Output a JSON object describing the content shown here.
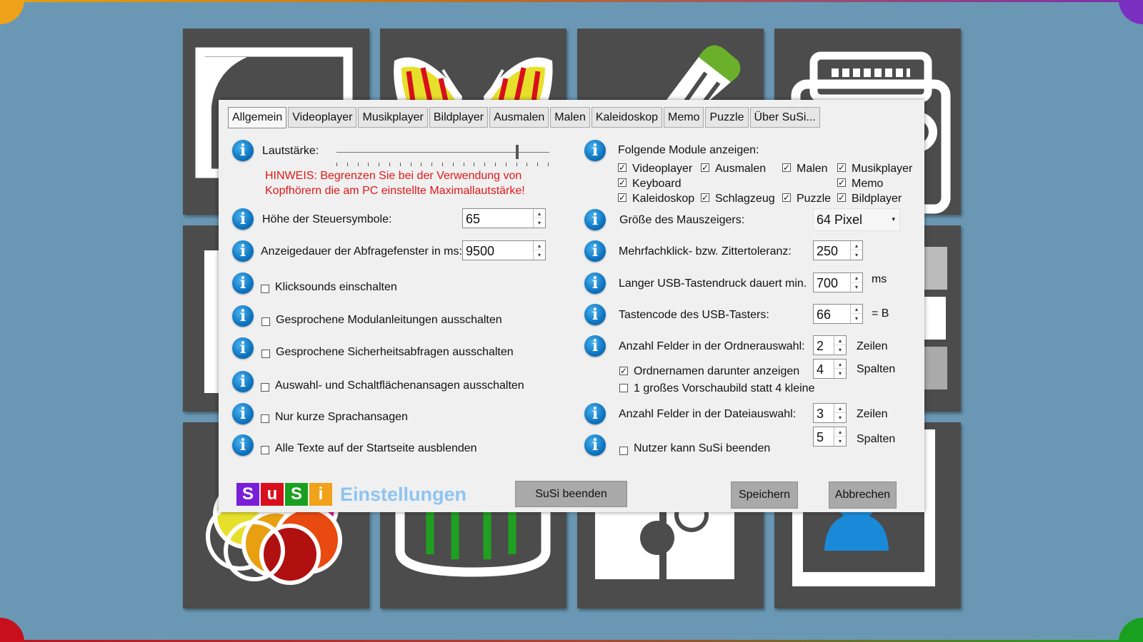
{
  "colors": {
    "background": "#6a98b4",
    "tile": "#4c4c4c",
    "dialog": "#f0f0f0",
    "hint": "#e01818",
    "info_icon": "#0e74c0",
    "logo_s1": "#7a1fd8",
    "logo_u": "#d8101e",
    "logo_s2": "#1aa020",
    "logo_i": "#f0a21a",
    "logo_title": "#8ec4f2"
  },
  "tabs": [
    "Allgemein",
    "Videoplayer",
    "Musikplayer",
    "Bildplayer",
    "Ausmalen",
    "Malen",
    "Kaleidoskop",
    "Memo",
    "Puzzle",
    "Über SuSi..."
  ],
  "active_tab": "Allgemein",
  "left": {
    "volume_label": "Lautstärke:",
    "volume_level": 0.85,
    "hint": "HINWEIS: Begrenzen Sie bei der Verwendung von",
    "hint2": "Kopfhörern die am PC einstellte Maximallautstärke!",
    "icon_height_label": "Höhe der Steuersymbole:",
    "icon_height_value": "65",
    "prompt_duration_label": "Anzeigedauer der Abfragefenster in ms:",
    "prompt_duration_value": "9500",
    "options": [
      {
        "label": "Klicksounds einschalten",
        "checked": false
      },
      {
        "label": "Gesprochene Modulanleitungen ausschalten",
        "checked": false
      },
      {
        "label": "Gesprochene Sicherheitsabfragen ausschalten",
        "checked": false
      },
      {
        "label": "Auswahl- und Schaltflächenansagen ausschalten",
        "checked": false
      },
      {
        "label": "Nur kurze Sprachansagen",
        "checked": false
      },
      {
        "label": "Alle Texte auf der Startseite ausblenden",
        "checked": false
      }
    ]
  },
  "right": {
    "modules_label": "Folgende Module anzeigen:",
    "modules": [
      {
        "label": "Videoplayer",
        "checked": true
      },
      {
        "label": "Ausmalen",
        "checked": true
      },
      {
        "label": "Malen",
        "checked": true
      },
      {
        "label": "Musikplayer",
        "checked": true
      },
      {
        "label": "Keyboard",
        "checked": true
      },
      {
        "label": "Memo",
        "checked": true
      },
      {
        "label": "Kaleidoskop",
        "checked": true
      },
      {
        "label": "Schlagzeug",
        "checked": true
      },
      {
        "label": "Puzzle",
        "checked": true
      },
      {
        "label": "Bildplayer",
        "checked": true
      }
    ],
    "cursor_size_label": "Größe des Mauszeigers:",
    "cursor_size_value": "64 Pixel",
    "multiclick_label": "Mehrfachklick- bzw. Zittertoleranz:",
    "multiclick_value": "250",
    "usb_long_label": "Langer USB-Tastendruck dauert min.",
    "usb_long_value": "700",
    "usb_long_unit": "ms",
    "usb_key_label": "Tastencode des USB-Tasters:",
    "usb_key_value": "66",
    "usb_key_char": "= B",
    "folder_fields_label": "Anzahl Felder in der Ordnerauswahl:",
    "folder_rows_value": "2",
    "folder_rows_unit": "Zeilen",
    "folder_names_label": "Ordnernamen darunter anzeigen",
    "folder_names_checked": true,
    "folder_cols_value": "4",
    "folder_cols_unit": "Spalten",
    "large_preview_label": "1 großes Vorschaubild statt 4 kleine",
    "large_preview_checked": false,
    "file_fields_label": "Anzahl Felder in der Dateiauswahl:",
    "file_rows_value": "3",
    "file_rows_unit": "Zeilen",
    "file_cols_value": "5",
    "file_cols_unit": "Spalten",
    "user_quit_label": "Nutzer kann SuSi beenden",
    "user_quit_checked": false
  },
  "footer": {
    "logo_letters": [
      "S",
      "u",
      "S",
      "i"
    ],
    "logo_title": "Einstellungen",
    "quit_button": "SuSi  beenden",
    "save_button": "Speichern",
    "cancel_button": "Abbrechen"
  },
  "icons": {
    "info": "info-icon",
    "spin_up": "▴",
    "spin_down": "▾",
    "combo_arrow": "▾",
    "check": "✓"
  }
}
